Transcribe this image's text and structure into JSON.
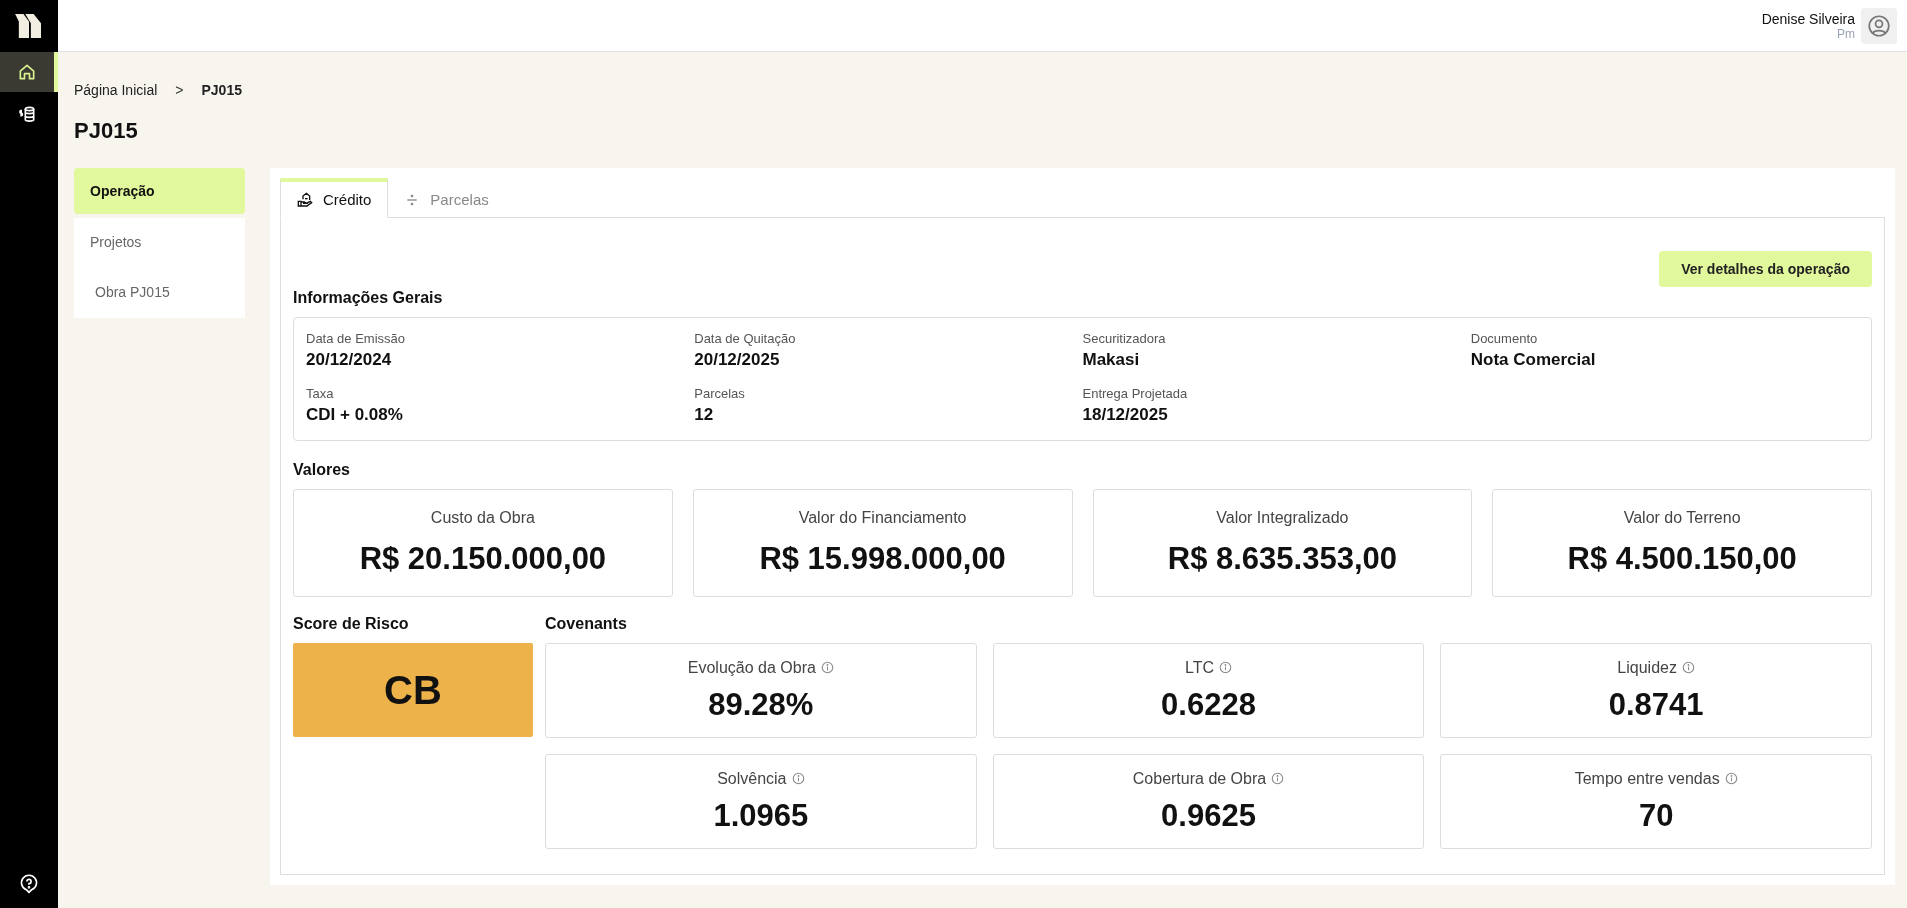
{
  "rail": {
    "items": [
      {
        "kind": "home",
        "selected": true
      },
      {
        "kind": "money",
        "selected": false
      }
    ]
  },
  "user": {
    "name": "Denise Silveira",
    "role": "Pm"
  },
  "breadcrumb": [
    {
      "label": "Página Inicial",
      "current": false
    },
    {
      "label": "PJ015",
      "current": true
    }
  ],
  "breadcrumb_separator": ">",
  "page_title": "PJ015",
  "side_menu": [
    {
      "label": "Operação",
      "selected": true
    },
    {
      "label": "Projetos",
      "selected": false,
      "children": [
        {
          "label": "Obra PJ015",
          "selected": false
        }
      ]
    }
  ],
  "tabs": [
    {
      "label": "Crédito",
      "kind": "credit",
      "selected": true
    },
    {
      "label": "Parcelas",
      "kind": "installments",
      "selected": false
    }
  ],
  "details_button": "Ver detalhes da operação",
  "general_info": {
    "title": "Informações Gerais",
    "fields": [
      {
        "label": "Data de Emissão",
        "value": "20/12/2024"
      },
      {
        "label": "Data de Quitação",
        "value": "20/12/2025"
      },
      {
        "label": "Securitizadora",
        "value": "Makasi"
      },
      {
        "label": "Documento",
        "value": "Nota Comercial"
      },
      {
        "label": "Taxa",
        "value": "CDI + 0.08%"
      },
      {
        "label": "Parcelas",
        "value": "12"
      },
      {
        "label": "Entrega Projetada",
        "value": "18/12/2025"
      }
    ]
  },
  "values": {
    "title": "Valores",
    "cards": [
      {
        "label": "Custo da Obra",
        "value": "R$ 20.150.000,00"
      },
      {
        "label": "Valor do Financiamento",
        "value": "R$ 15.998.000,00"
      },
      {
        "label": "Valor Integralizado",
        "value": "R$ 8.635.353,00"
      },
      {
        "label": "Valor do Terreno",
        "value": "R$ 4.500.150,00"
      }
    ]
  },
  "risk_score": {
    "title": "Score de Risco",
    "value": "CB",
    "color": "#edb24a"
  },
  "covenants": {
    "title": "Covenants",
    "cards": [
      {
        "label": "Evolução da Obra",
        "value": "89.28%"
      },
      {
        "label": "LTC",
        "value": "0.6228"
      },
      {
        "label": "Liquidez",
        "value": "0.8741"
      },
      {
        "label": "Solvência",
        "value": "1.0965"
      },
      {
        "label": "Cobertura de Obra",
        "value": "0.9625"
      },
      {
        "label": "Tempo entre vendas",
        "value": "70"
      }
    ]
  }
}
